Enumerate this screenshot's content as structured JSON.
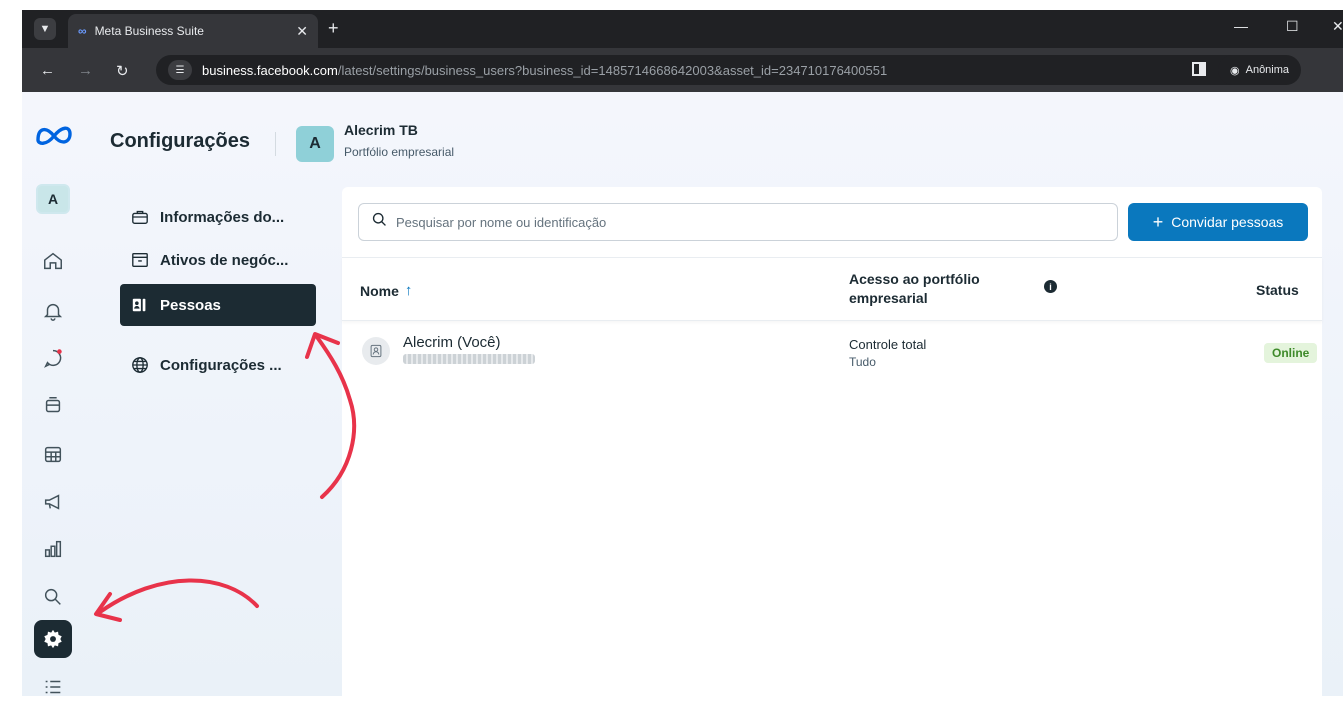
{
  "browser": {
    "tab_title": "Meta Business Suite",
    "url_host": "business.facebook.com",
    "url_path": "/latest/settings/business_users?business_id=1485714668642003&asset_id=234710176400551",
    "incognito_label": "Anônima"
  },
  "header": {
    "title": "Configurações",
    "business_avatar_letter": "A",
    "business_name": "Alecrim TB",
    "business_subtitle": "Portfólio empresarial"
  },
  "rail": {
    "avatar_letter": "A",
    "items": [
      "home-icon",
      "bell-icon",
      "chat-icon",
      "posts-icon",
      "calendar-icon",
      "megaphone-icon",
      "insights-icon",
      "search-icon",
      "settings-icon",
      "menu-icon"
    ],
    "active": "settings-icon"
  },
  "settings_menu": {
    "items": [
      {
        "label": "Informações do...",
        "icon": "briefcase-icon"
      },
      {
        "label": "Ativos de negóc...",
        "icon": "archive-icon"
      },
      {
        "label": "Pessoas",
        "icon": "people-icon",
        "active": true
      },
      {
        "label": "Configurações ...",
        "icon": "globe-icon"
      }
    ]
  },
  "main": {
    "search_placeholder": "Pesquisar por nome ou identificação",
    "invite_button": "Convidar pessoas",
    "columns": {
      "name": "Nome",
      "access": "Acesso ao portfólio empresarial",
      "status": "Status"
    },
    "rows": [
      {
        "name": "Alecrim (Você)",
        "access": "Controle total",
        "scope": "Tudo",
        "status": "Online"
      }
    ]
  },
  "colors": {
    "accent": "#0a78be",
    "dark": "#1c2b33",
    "annotation": "#e8334a",
    "online": "#3e8a2a"
  }
}
